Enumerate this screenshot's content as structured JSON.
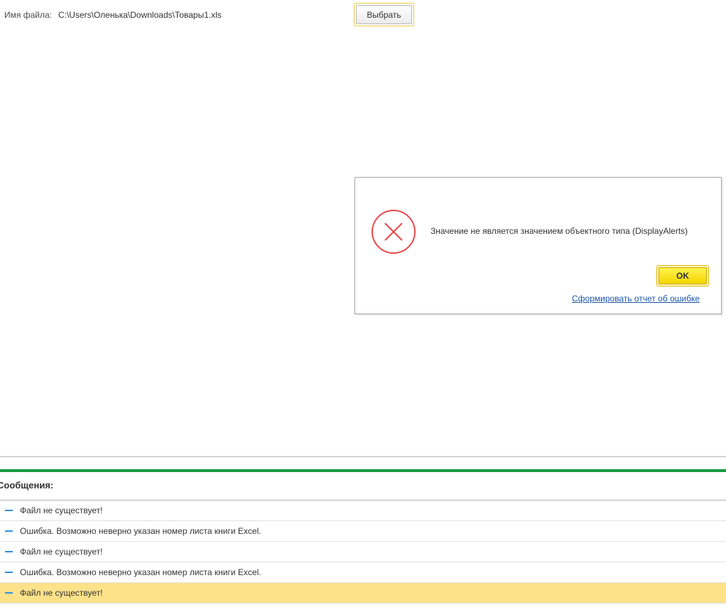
{
  "file": {
    "label": "Имя файла:",
    "path": "C:\\Users\\Оленька\\Downloads\\Товары1.xls",
    "choose_button": "Выбрать"
  },
  "dialog": {
    "icon": "error-x-icon",
    "message": "Значение не является значением объектного типа (DisplayAlerts)",
    "ok_button": "OK",
    "report_link": "Сформировать отчет об ошибке"
  },
  "messages": {
    "title": "Сообщения:",
    "items": [
      {
        "text": "Файл не существует!"
      },
      {
        "text": "Ошибка. Возможно неверно указан номер листа книги Excel."
      },
      {
        "text": "Файл не существует!"
      },
      {
        "text": "Ошибка. Возможно неверно указан номер листа книги Excel."
      },
      {
        "text": "Файл не существует!",
        "selected": true
      }
    ]
  },
  "colors": {
    "accent_green": "#169a43",
    "error_red": "#e84a4a",
    "ok_yellow": "#f5d500",
    "selected_row": "#fde28a",
    "link_blue": "#1a55a8"
  }
}
